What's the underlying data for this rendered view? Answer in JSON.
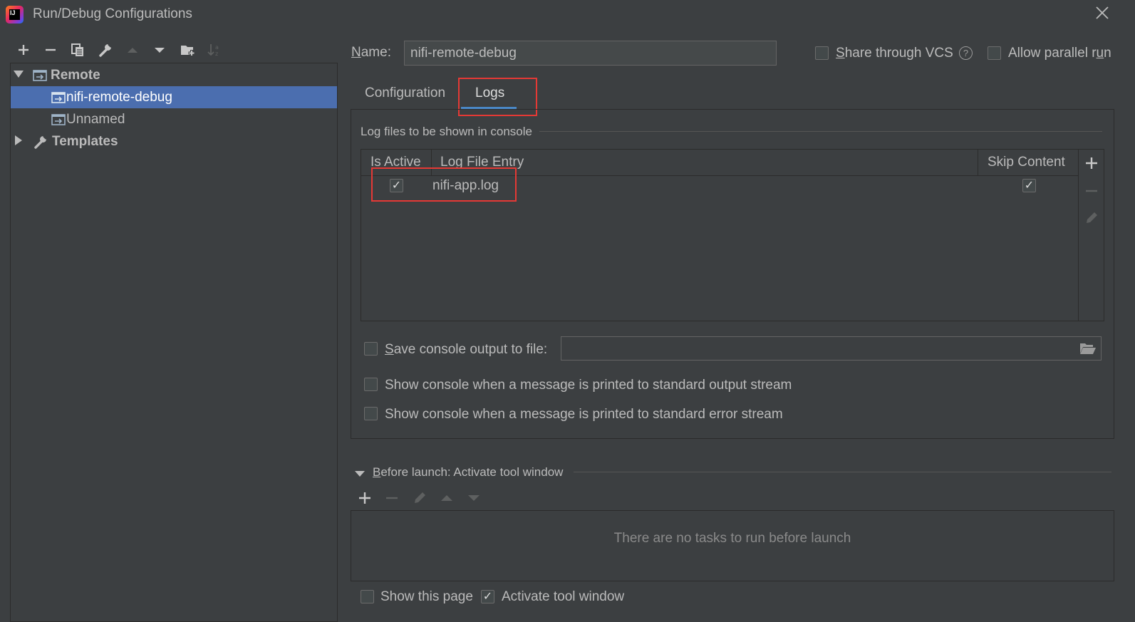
{
  "window": {
    "title": "Run/Debug Configurations",
    "close_icon": "close-icon"
  },
  "toolbar": {
    "icons": [
      "add-icon",
      "remove-icon",
      "copy-icon",
      "wrench-icon",
      "move-up-icon",
      "move-down-icon",
      "new-folder-icon",
      "sort-icon"
    ]
  },
  "tree": {
    "remote_label": "Remote",
    "items": [
      {
        "label": "nifi-remote-debug",
        "selected": true
      },
      {
        "label": "Unnamed",
        "selected": false
      }
    ],
    "templates_label": "Templates"
  },
  "header": {
    "name_label_prefix": "N",
    "name_label_rest": "ame:",
    "name_value": "nifi-remote-debug",
    "share_vcs_prefix": "S",
    "share_vcs_rest": "hare through VCS",
    "share_vcs_checked": false,
    "allow_parallel_pre": "Allow parallel r",
    "allow_parallel_u": "u",
    "allow_parallel_post": "n",
    "allow_parallel_checked": false
  },
  "tabs": [
    {
      "label": "Configuration",
      "active": false
    },
    {
      "label": "Logs",
      "active": true
    }
  ],
  "logs": {
    "section_title": "Log files to be shown in console",
    "columns": [
      "Is Active",
      "Log File Entry",
      "Skip Content"
    ],
    "rows": [
      {
        "is_active": true,
        "entry": "nifi-app.log",
        "skip_content": true
      }
    ],
    "save_output_pre": "S",
    "save_output_rest": "ave console output to file:",
    "save_output_checked": false,
    "save_output_path": "",
    "show_stdout": "Show console when a message is printed to standard output stream",
    "show_stdout_checked": false,
    "show_stderr": "Show console when a message is printed to standard error stream",
    "show_stderr_checked": false
  },
  "before_launch": {
    "title_pre": "B",
    "title_rest": "efore launch: Activate tool window",
    "empty_text": "There are no tasks to run before launch",
    "show_page_label": "Show this page",
    "show_page_checked": false,
    "activate_label": "Activate tool window",
    "activate_checked": true
  },
  "colors": {
    "accent": "#4a88c7",
    "selection": "#4b6eaf",
    "highlight": "#e53935",
    "background": "#3c3f41"
  }
}
